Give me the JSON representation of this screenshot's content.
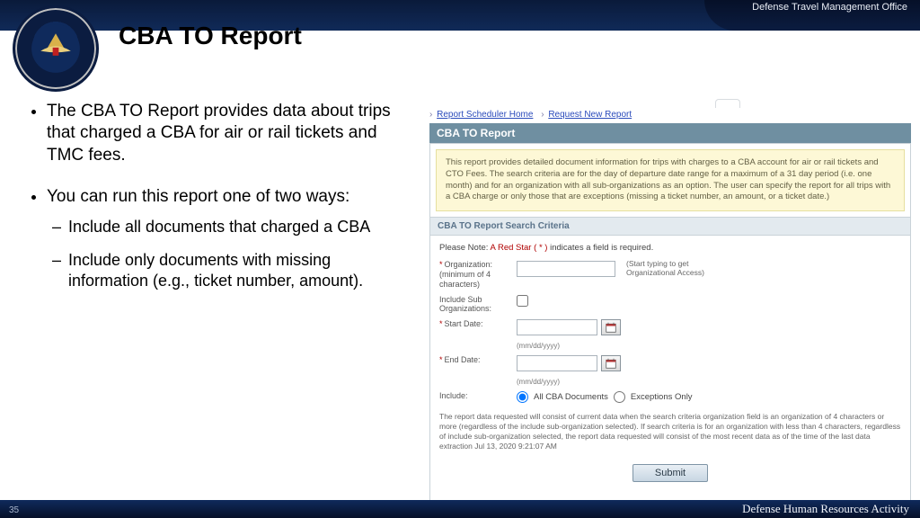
{
  "header": {
    "top_right": "Defense Travel Management Office",
    "title": "CBA TO Report"
  },
  "bullets": {
    "b1": "The CBA TO Report provides data about trips that charged a CBA for air or rail tickets and TMC fees.",
    "b2": "You can run this report one of two ways:",
    "s1": "Include all documents that charged a CBA",
    "s2": "Include only documents with missing information (e.g., ticket number, amount)."
  },
  "breadcrumb": {
    "home": "Report Scheduler Home",
    "new": "Request New Report"
  },
  "panel": {
    "title": "CBA TO Report",
    "info": "This report provides detailed document information for trips with charges to a CBA account for air or rail tickets and CTO Fees. The search criteria are for the day of departure date range for a maximum of a 31 day period (i.e. one month) and for an organization with all sub-organizations as an option. The user can specify the report for all trips with a CBA charge or only those that are exceptions (missing a ticket number, an amount, or a ticket date.)",
    "section": "CBA TO Report Search Criteria",
    "note_prefix": "Please Note:",
    "note_redstar": "A Red Star",
    "note_suffix": "indicates a field is required.",
    "org_label": "Organization: (minimum of 4 characters)",
    "org_hint": "(Start typing to get Organizational Access)",
    "include_suborgs": "Include Sub Organizations:",
    "start_date": "Start Date:",
    "end_date": "End Date:",
    "date_fmt": "(mm/dd/yyyy)",
    "include_lbl": "Include:",
    "radio_all": "All CBA Documents",
    "radio_exc": "Exceptions Only",
    "disclaimer": "The report data requested will consist of current data when the search criteria organization field is an organization of 4 characters or more (regardless of the include sub-organization selected). If search criteria is for an organization with less than 4 characters, regardless of include sub-organization selected, the report data requested will consist of the most recent data as of the time of the last data extraction Jul 13, 2020 9:21:07 AM",
    "submit": "Submit"
  },
  "footer": {
    "page": "35",
    "right": "Defense Human Resources Activity"
  }
}
